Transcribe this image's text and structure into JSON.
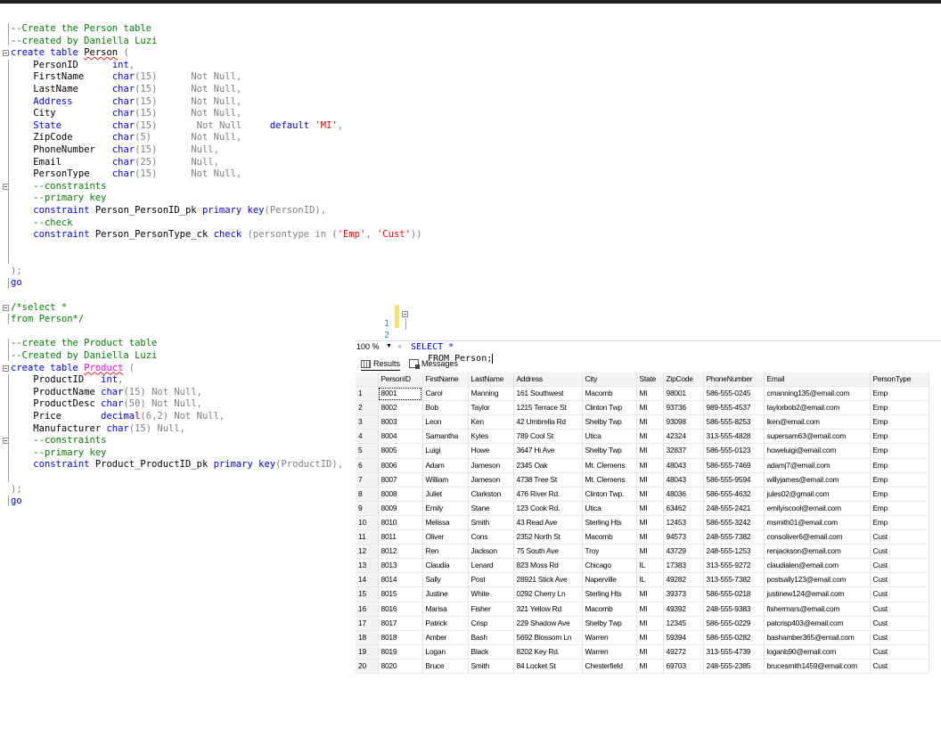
{
  "code_lines": [
    {
      "indent": "",
      "fold": false,
      "parts": [
        {
          "t": "--Create the Person table",
          "c": "cm"
        }
      ]
    },
    {
      "indent": "",
      "fold": false,
      "parts": [
        {
          "t": "--created by Daniella Luzi",
          "c": "cm"
        }
      ]
    },
    {
      "indent": "",
      "fold": true,
      "parts": [
        {
          "t": "create table ",
          "c": "kw"
        },
        {
          "t": "Person",
          "c": "sq"
        },
        {
          "t": " (",
          "c": "gr"
        }
      ]
    },
    {
      "indent": "    ",
      "fold": false,
      "parts": [
        {
          "t": "PersonID      ",
          "c": ""
        },
        {
          "t": "int",
          "c": "kw"
        },
        {
          "t": ",",
          "c": "gr"
        }
      ]
    },
    {
      "indent": "    ",
      "fold": false,
      "parts": [
        {
          "t": "FirstName     ",
          "c": ""
        },
        {
          "t": "char",
          "c": "kw"
        },
        {
          "t": "(15)      ",
          "c": "gr"
        },
        {
          "t": "Not Null,",
          "c": "gr"
        }
      ]
    },
    {
      "indent": "    ",
      "fold": false,
      "parts": [
        {
          "t": "LastName      ",
          "c": ""
        },
        {
          "t": "char",
          "c": "kw"
        },
        {
          "t": "(15)      ",
          "c": "gr"
        },
        {
          "t": "Not Null,",
          "c": "gr"
        }
      ]
    },
    {
      "indent": "    ",
      "fold": false,
      "parts": [
        {
          "t": "Address       ",
          "c": "kw"
        },
        {
          "t": "char",
          "c": "kw"
        },
        {
          "t": "(15)      ",
          "c": "gr"
        },
        {
          "t": "Not Null,",
          "c": "gr"
        }
      ]
    },
    {
      "indent": "    ",
      "fold": false,
      "parts": [
        {
          "t": "City          ",
          "c": ""
        },
        {
          "t": "char",
          "c": "kw"
        },
        {
          "t": "(15)      ",
          "c": "gr"
        },
        {
          "t": "Not Null,",
          "c": "gr"
        }
      ]
    },
    {
      "indent": "    ",
      "fold": false,
      "parts": [
        {
          "t": "State         ",
          "c": "kw"
        },
        {
          "t": "char",
          "c": "kw"
        },
        {
          "t": "(15)       ",
          "c": "gr"
        },
        {
          "t": "Not Null     ",
          "c": "gr"
        },
        {
          "t": "default ",
          "c": "kw"
        },
        {
          "t": "'MI'",
          "c": "str"
        },
        {
          "t": ",",
          "c": "gr"
        }
      ]
    },
    {
      "indent": "    ",
      "fold": false,
      "parts": [
        {
          "t": "ZipCode       ",
          "c": ""
        },
        {
          "t": "char",
          "c": "kw"
        },
        {
          "t": "(5)       ",
          "c": "gr"
        },
        {
          "t": "Not Null,",
          "c": "gr"
        }
      ]
    },
    {
      "indent": "    ",
      "fold": false,
      "parts": [
        {
          "t": "PhoneNumber   ",
          "c": ""
        },
        {
          "t": "char",
          "c": "kw"
        },
        {
          "t": "(15)      ",
          "c": "gr"
        },
        {
          "t": "Null,",
          "c": "gr"
        }
      ]
    },
    {
      "indent": "    ",
      "fold": false,
      "parts": [
        {
          "t": "Email         ",
          "c": ""
        },
        {
          "t": "char",
          "c": "kw"
        },
        {
          "t": "(25)      ",
          "c": "gr"
        },
        {
          "t": "Null,",
          "c": "gr"
        }
      ]
    },
    {
      "indent": "    ",
      "fold": false,
      "parts": [
        {
          "t": "PersonType    ",
          "c": ""
        },
        {
          "t": "char",
          "c": "kw"
        },
        {
          "t": "(15)      ",
          "c": "gr"
        },
        {
          "t": "Not Null,",
          "c": "gr"
        }
      ]
    },
    {
      "indent": "    ",
      "fold": true,
      "parts": [
        {
          "t": "--constraints",
          "c": "cm"
        }
      ]
    },
    {
      "indent": "    ",
      "fold": false,
      "parts": [
        {
          "t": "--primary key",
          "c": "cm"
        }
      ]
    },
    {
      "indent": "    ",
      "fold": false,
      "parts": [
        {
          "t": "constraint ",
          "c": "kw"
        },
        {
          "t": "Person_PersonID_pk ",
          "c": ""
        },
        {
          "t": "primary key",
          "c": "kw"
        },
        {
          "t": "(PersonID),",
          "c": "gr"
        }
      ]
    },
    {
      "indent": "    ",
      "fold": false,
      "parts": [
        {
          "t": "--check",
          "c": "cm"
        }
      ]
    },
    {
      "indent": "    ",
      "fold": false,
      "parts": [
        {
          "t": "constraint ",
          "c": "kw"
        },
        {
          "t": "Person_PersonType_ck ",
          "c": ""
        },
        {
          "t": "check ",
          "c": "kw"
        },
        {
          "t": "(persontype ",
          "c": "gr"
        },
        {
          "t": "in ",
          "c": "gr"
        },
        {
          "t": "(",
          "c": "gr"
        },
        {
          "t": "'Emp'",
          "c": "str"
        },
        {
          "t": ", ",
          "c": "gr"
        },
        {
          "t": "'Cust'",
          "c": "str"
        },
        {
          "t": "))",
          "c": "gr"
        }
      ]
    },
    {
      "indent": "",
      "fold": false,
      "parts": []
    },
    {
      "indent": "",
      "fold": false,
      "parts": []
    },
    {
      "indent": "",
      "fold": false,
      "parts": [
        {
          "t": ");",
          "c": "gr"
        }
      ]
    },
    {
      "indent": "",
      "fold": false,
      "parts": [
        {
          "t": "go",
          "c": "kw"
        }
      ]
    },
    {
      "indent": "",
      "fold": false,
      "parts": []
    },
    {
      "indent": "",
      "fold": true,
      "parts": [
        {
          "t": "/*select *",
          "c": "cm"
        }
      ]
    },
    {
      "indent": "",
      "fold": false,
      "parts": [
        {
          "t": "from Person*/",
          "c": "cm"
        }
      ]
    },
    {
      "indent": "",
      "fold": false,
      "parts": []
    },
    {
      "indent": "",
      "fold": false,
      "parts": [
        {
          "t": "--create the Product table",
          "c": "cm"
        }
      ]
    },
    {
      "indent": "",
      "fold": false,
      "parts": [
        {
          "t": "--Created by Daniella Luzi",
          "c": "cm"
        }
      ]
    },
    {
      "indent": "",
      "fold": true,
      "parts": [
        {
          "t": "create table ",
          "c": "kw"
        },
        {
          "t": "Product",
          "c": "pksq"
        },
        {
          "t": " (",
          "c": "gr"
        }
      ]
    },
    {
      "indent": "    ",
      "fold": false,
      "parts": [
        {
          "t": "ProductID   ",
          "c": ""
        },
        {
          "t": "int",
          "c": "kw"
        },
        {
          "t": ",",
          "c": "gr"
        }
      ]
    },
    {
      "indent": "    ",
      "fold": false,
      "parts": [
        {
          "t": "ProductName ",
          "c": ""
        },
        {
          "t": "char",
          "c": "kw"
        },
        {
          "t": "(15) ",
          "c": "gr"
        },
        {
          "t": "Not Null,",
          "c": "gr"
        }
      ]
    },
    {
      "indent": "    ",
      "fold": false,
      "parts": [
        {
          "t": "ProductDesc ",
          "c": ""
        },
        {
          "t": "char",
          "c": "kw"
        },
        {
          "t": "(50) ",
          "c": "gr"
        },
        {
          "t": "Not Null,",
          "c": "gr"
        }
      ]
    },
    {
      "indent": "    ",
      "fold": false,
      "parts": [
        {
          "t": "Price       ",
          "c": ""
        },
        {
          "t": "decimal",
          "c": "kw"
        },
        {
          "t": "(6,2) ",
          "c": "gr"
        },
        {
          "t": "Not Null,",
          "c": "gr"
        }
      ]
    },
    {
      "indent": "    ",
      "fold": false,
      "parts": [
        {
          "t": "Manufacturer ",
          "c": ""
        },
        {
          "t": "char",
          "c": "kw"
        },
        {
          "t": "(15) ",
          "c": "gr"
        },
        {
          "t": "Null,",
          "c": "gr"
        }
      ]
    },
    {
      "indent": "    ",
      "fold": true,
      "parts": [
        {
          "t": "--constraints",
          "c": "cm"
        }
      ]
    },
    {
      "indent": "    ",
      "fold": false,
      "parts": [
        {
          "t": "--primary key",
          "c": "cm"
        }
      ]
    },
    {
      "indent": "    ",
      "fold": false,
      "parts": [
        {
          "t": "constraint ",
          "c": "kw"
        },
        {
          "t": "Product_ProductID_pk ",
          "c": ""
        },
        {
          "t": "primary key",
          "c": "kw"
        },
        {
          "t": "(ProductID),",
          "c": "gr"
        }
      ]
    },
    {
      "indent": "",
      "fold": false,
      "parts": []
    },
    {
      "indent": "",
      "fold": false,
      "parts": [
        {
          "t": ");",
          "c": "gr"
        }
      ]
    },
    {
      "indent": "",
      "fold": false,
      "parts": [
        {
          "t": "go",
          "c": "kw"
        }
      ]
    }
  ],
  "query": {
    "line1_num": "1",
    "line1_text": "SELECT *",
    "line2_num": "2",
    "line2_text": "FROM Person;"
  },
  "zoom": {
    "value": "100 %",
    "dropdown_icon": "chevron-down-icon"
  },
  "tabs": {
    "results": "Results",
    "messages": "Messages",
    "results_icon": "grid-icon",
    "messages_icon": "messages-icon"
  },
  "results": {
    "columns": [
      "",
      "PersonID",
      "FirstName",
      "LastName",
      "Address",
      "City",
      "State",
      "ZipCode",
      "PhoneNumber",
      "Email",
      "PersonType"
    ],
    "rows": [
      [
        "1",
        "8001",
        "Carol",
        "Manning",
        "161 Southwest",
        "Macomb",
        "MI",
        "98001",
        "586-555-0245",
        "cmanning135@email.com",
        "Emp"
      ],
      [
        "2",
        "8002",
        "Bob",
        "Taylor",
        "1215 Terrace St",
        "Clinton Twp",
        "MI",
        "93736",
        "989-555-4537",
        "taylorbob2@email.com",
        "Emp"
      ],
      [
        "3",
        "8003",
        "Leon",
        "Ken",
        "42 Umbrella Rd",
        "Shelby Twp",
        "MI",
        "93098",
        "586-555-8253",
        "lken@email.com",
        "Emp"
      ],
      [
        "4",
        "8004",
        "Samantha",
        "Kyles",
        "789 Cool St",
        "Utica",
        "MI",
        "42324",
        "313-555-4828",
        "supersam63@email.com",
        "Emp"
      ],
      [
        "5",
        "8005",
        "Luigi",
        "Howe",
        "3647 Hi Ave",
        "Shelby Twp",
        "MI",
        "32837",
        "586-555-0123",
        "howeluigi@email.com",
        "Emp"
      ],
      [
        "6",
        "8006",
        "Adam",
        "Jameson",
        "2345 Oak",
        "Mt. Clemens",
        "MI",
        "48043",
        "586-555-7469",
        "adamj7@email.com",
        "Emp"
      ],
      [
        "7",
        "8007",
        "William",
        "Jameson",
        "4738 Tree St",
        "Mt. Clemens",
        "MI",
        "48043",
        "586-555-9594",
        "willyjames@email.com",
        "Emp"
      ],
      [
        "8",
        "8008",
        "Juliet",
        "Clarkston",
        "476 River Rd.",
        "Clinton Twp.",
        "MI",
        "48036",
        "586-555-4632",
        "jules02@gmail.com",
        "Emp"
      ],
      [
        "9",
        "8009",
        "Emily",
        "Stane",
        "123 Cook Rd.",
        "Utica",
        "MI",
        "63462",
        "248-555-2421",
        "emilyiscool@email.com",
        "Emp"
      ],
      [
        "10",
        "8010",
        "Melissa",
        "Smith",
        "43 Read Ave",
        "Sterling Hts",
        "MI",
        "12453",
        "586-555-3242",
        "msmith01@email.com",
        "Emp"
      ],
      [
        "11",
        "8011",
        "Oliver",
        "Cons",
        "2352 North St",
        "Macomb",
        "MI",
        "94573",
        "248-555-7382",
        "consoliver6@email.com",
        "Cust"
      ],
      [
        "12",
        "8012",
        "Ren",
        "Jackson",
        "75 South Ave",
        "Troy",
        "MI",
        "43729",
        "248-555-1253",
        "renjackson@email.com",
        "Cust"
      ],
      [
        "13",
        "8013",
        "Claudia",
        "Lenard",
        "823 Moss Rd",
        "Chicago",
        "IL",
        "17383",
        "313-555-9272",
        "claudialen@email.com",
        "Cust"
      ],
      [
        "14",
        "8014",
        "Sally",
        "Post",
        "28921 Stick Ave",
        "Naperville",
        "IL",
        "49282",
        "313-555-7382",
        "postsally123@email.com",
        "Cust"
      ],
      [
        "15",
        "8015",
        "Justine",
        "White",
        "0292 Cherry Ln",
        "Sterling Hts",
        "MI",
        "39373",
        "586-555-0218",
        "justinew124@email.com",
        "Cust"
      ],
      [
        "16",
        "8016",
        "Marisa",
        "Fisher",
        "321 Yellow Rd",
        "Macomb",
        "MI",
        "49392",
        "248-555-9383",
        "fishermars@email.com",
        "Cust"
      ],
      [
        "17",
        "8017",
        "Patrick",
        "Crisp",
        "229 Shadow Ave",
        "Shelby Twp",
        "MI",
        "12345",
        "586-555-0229",
        "patcrisp403@email.com",
        "Cust"
      ],
      [
        "18",
        "8018",
        "Amber",
        "Bash",
        "5692 Blossom Ln",
        "Warren",
        "MI",
        "59394",
        "586-555-0282",
        "bashamber365@email.com",
        "Cust"
      ],
      [
        "19",
        "8019",
        "Logan",
        "Black",
        "8202 Key Rd.",
        "Warren",
        "MI",
        "49272",
        "313-555-4739",
        "loganb90@email.com",
        "Cust"
      ],
      [
        "20",
        "8020",
        "Bruce",
        "Smith",
        "84 Locket St",
        "Chesterfield",
        "MI",
        "69703",
        "248-555-2385",
        "brucesmith1459@email.com",
        "Cust"
      ]
    ]
  },
  "colors": {
    "comment": "#008000",
    "keyword": "#0000ff",
    "string": "#ff0000",
    "gray": "#808080",
    "magenta": "#ff00ff",
    "line_number": "#2b91af",
    "change_marker": "#f7e16d"
  }
}
